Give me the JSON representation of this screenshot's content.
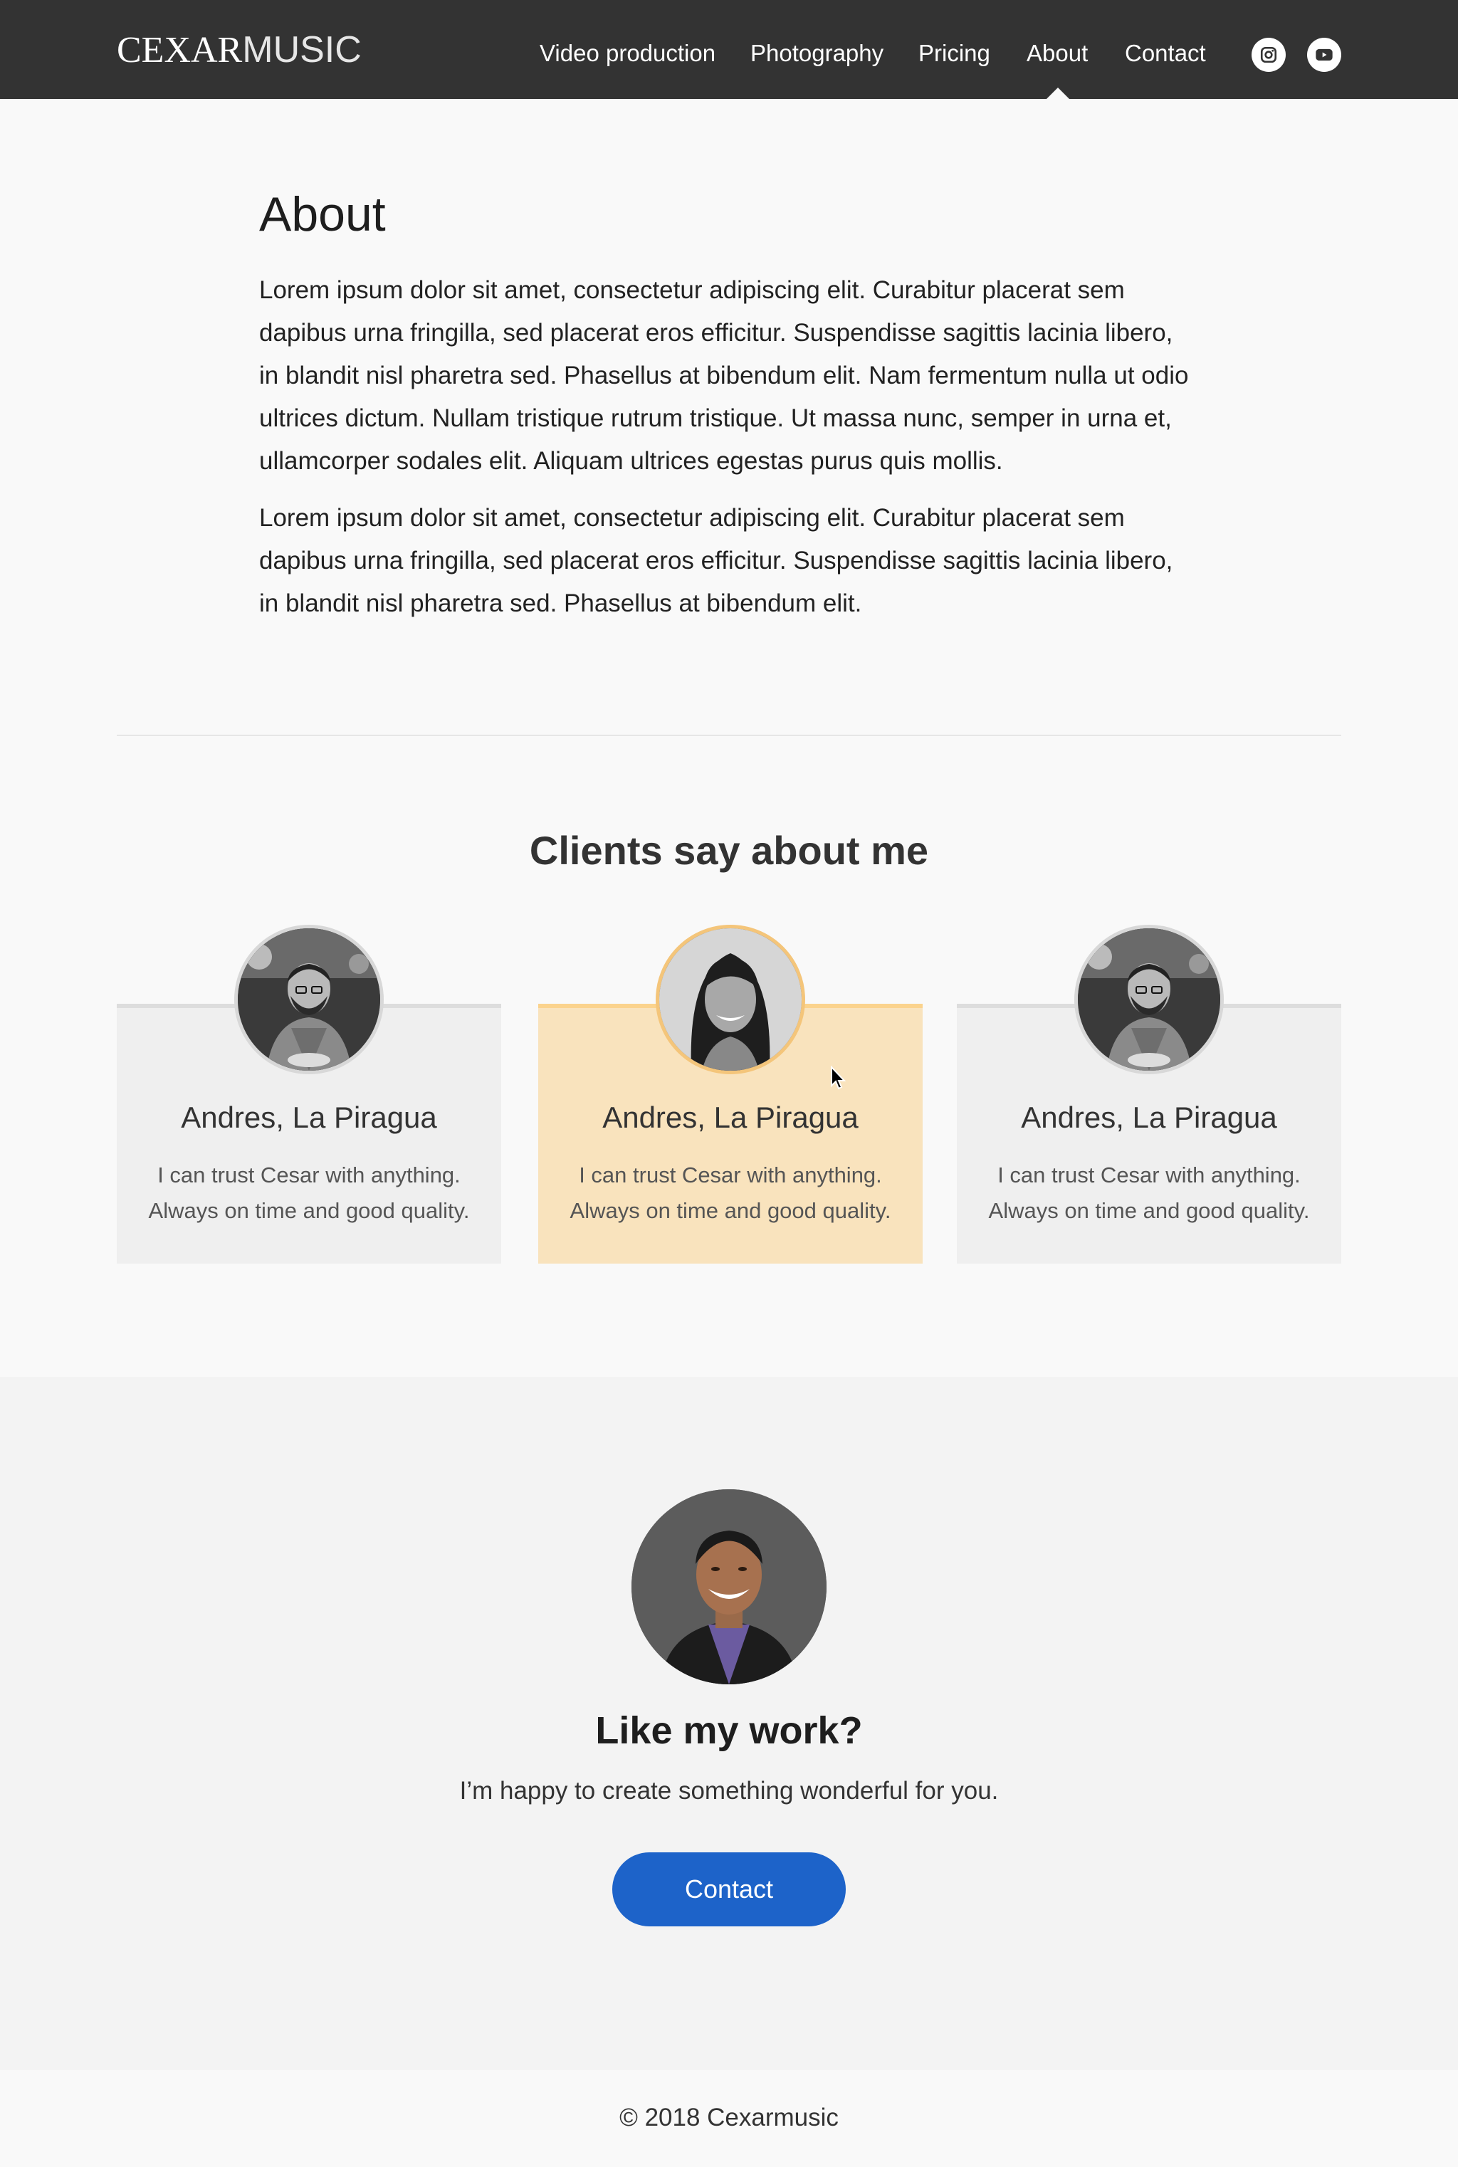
{
  "header": {
    "logo_bold": "CEXAR",
    "logo_light": "MUSIC",
    "nav": [
      {
        "label": "Video production"
      },
      {
        "label": "Photography"
      },
      {
        "label": "Pricing"
      },
      {
        "label": "About",
        "active": true
      },
      {
        "label": "Contact"
      }
    ],
    "social": [
      {
        "icon": "instagram-icon"
      },
      {
        "icon": "youtube-icon"
      }
    ]
  },
  "about": {
    "title": "About",
    "paragraphs": [
      "Lorem ipsum dolor sit amet, consectetur adipiscing elit. Curabitur placerat sem dapibus urna fringilla, sed placerat eros efficitur. Suspendisse sagittis lacinia libero, in blandit nisl pharetra sed. Phasellus at bibendum elit. Nam fermentum nulla ut odio ultrices dictum. Nullam tristique rutrum tristique. Ut massa nunc, semper in urna et, ullamcorper sodales elit. Aliquam ultrices egestas purus quis mollis.",
      "Lorem ipsum dolor sit amet, consectetur adipiscing elit. Curabitur placerat sem dapibus urna fringilla, sed placerat eros efficitur. Suspendisse sagittis lacinia libero, in blandit nisl pharetra sed. Phasellus at bibendum elit."
    ]
  },
  "testimonials": {
    "title": "Clients say about me",
    "items": [
      {
        "name": "Andres, La Piragua",
        "quote": "I can trust Cesar with anything. Always on time and good quality.",
        "active": false
      },
      {
        "name": "Andres, La Piragua",
        "quote": "I can trust Cesar with anything. Always on time and good quality.",
        "active": true
      },
      {
        "name": "Andres, La Piragua",
        "quote": "I can trust Cesar with anything. Always on time and good quality.",
        "active": false
      }
    ]
  },
  "cta": {
    "title": "Like my work?",
    "subtitle": "I’m happy to create something wonderful for you.",
    "button_label": "Contact"
  },
  "footer": {
    "text": "© 2018 Cexarmusic"
  },
  "colors": {
    "header_bg": "#333333",
    "accent_button": "#1d63c9",
    "active_card": "#f9e3bd",
    "active_card_border": "#fbd38d"
  }
}
